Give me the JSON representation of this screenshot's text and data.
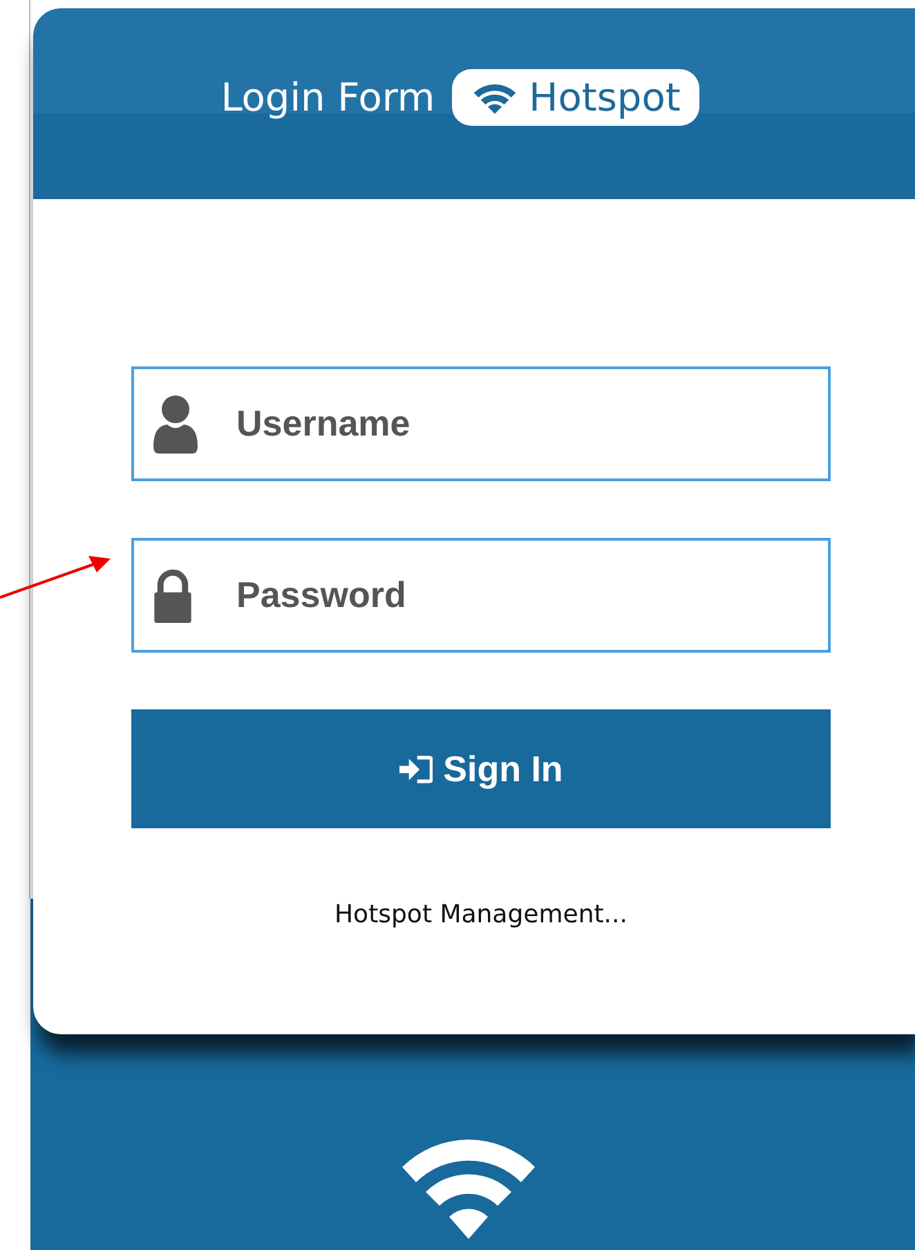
{
  "header": {
    "title": "Login Form",
    "badge": "Hotspot"
  },
  "fields": [
    {
      "kind": "user",
      "placeholder": "Username"
    },
    {
      "kind": "password",
      "placeholder": "Password"
    }
  ],
  "button": {
    "label": "Sign In"
  },
  "footer_link": "Hotspot Management..."
}
